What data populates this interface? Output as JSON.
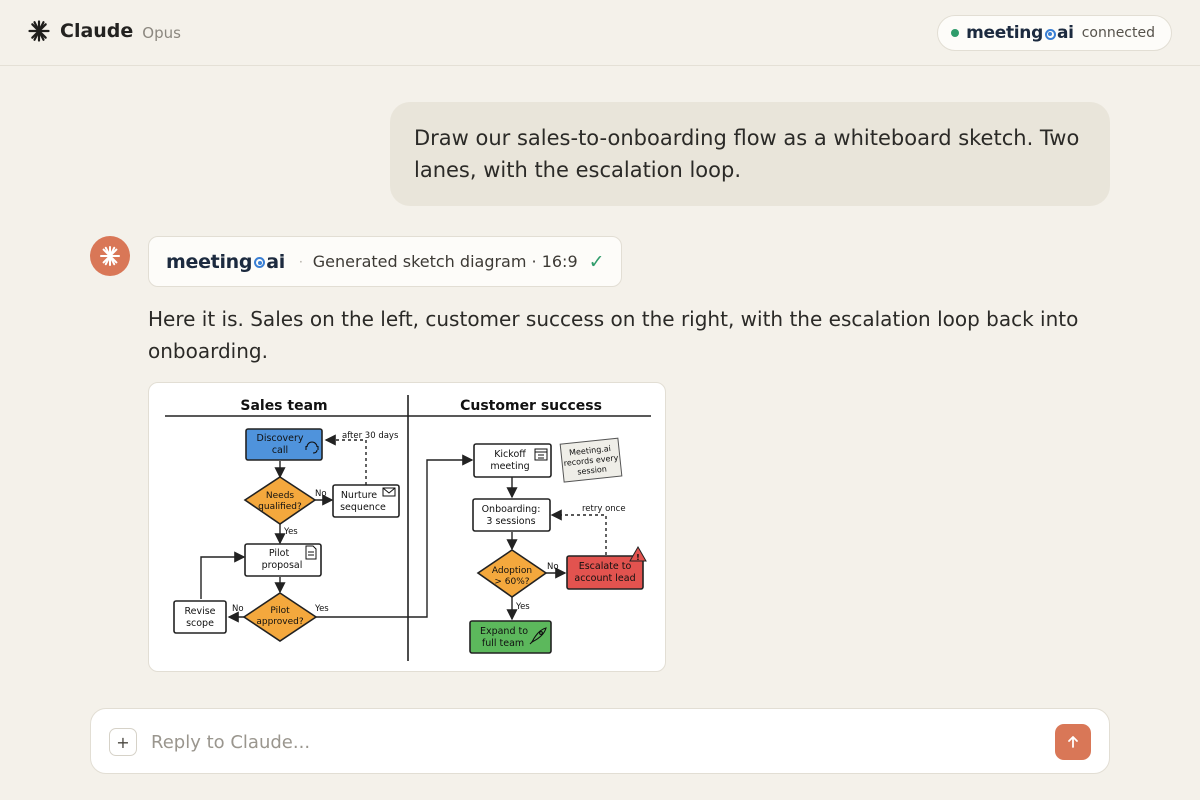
{
  "header": {
    "app_name": "Claude",
    "model": "Opus",
    "integration": {
      "brand_left": "meeting",
      "brand_right": "ai",
      "status": "connected"
    }
  },
  "conversation": {
    "user_message": "Draw our sales-to-onboarding flow as a whiteboard sketch. Two lanes, with the escalation loop.",
    "tool_chip": {
      "brand_left": "meeting",
      "brand_right": "ai",
      "label": "Generated sketch diagram · 16:9",
      "status_icon": "check-icon"
    },
    "assistant_message": "Here it is. Sales on the left, customer success on the right, with the escalation loop back into onboarding."
  },
  "diagram": {
    "lanes": {
      "left": "Sales team",
      "right": "Customer success"
    },
    "nodes": {
      "discovery_1": "Discovery",
      "discovery_2": "call",
      "needs_1": "Needs",
      "needs_2": "qualified?",
      "nurture_1": "Nurture",
      "nurture_2": "sequence",
      "pilot_1": "Pilot",
      "pilot_2": "proposal",
      "revise_1": "Revise",
      "revise_2": "scope",
      "approved_1": "Pilot",
      "approved_2": "approved?",
      "kickoff_1": "Kickoff",
      "kickoff_2": "meeting",
      "note_1": "Meeting.ai",
      "note_2": "records every",
      "note_3": "session",
      "onboarding_1": "Onboarding:",
      "onboarding_2": "3 sessions",
      "adoption_1": "Adoption",
      "adoption_2": "> 60%?",
      "escalate_1": "Escalate to",
      "escalate_2": "account lead",
      "expand_1": "Expand to",
      "expand_2": "full team"
    },
    "edge_labels": {
      "after_30": "after 30 days",
      "no_nurture": "No",
      "yes_pilot": "Yes",
      "no_revise": "No",
      "yes_kickoff": "Yes",
      "retry": "retry once",
      "no_escalate": "No",
      "yes_expand": "Yes"
    },
    "colors": {
      "discovery": "#4f93dc",
      "decision": "#f4a83d",
      "escalate": "#e2534f",
      "expand": "#5cb85c"
    }
  },
  "composer": {
    "placeholder": "Reply to Claude...",
    "add_icon": "plus-icon",
    "send_icon": "arrow-up-icon"
  },
  "colors": {
    "accent": "#d97757",
    "connected": "#2f9c6b",
    "brand_blue": "#3a7fd4"
  }
}
